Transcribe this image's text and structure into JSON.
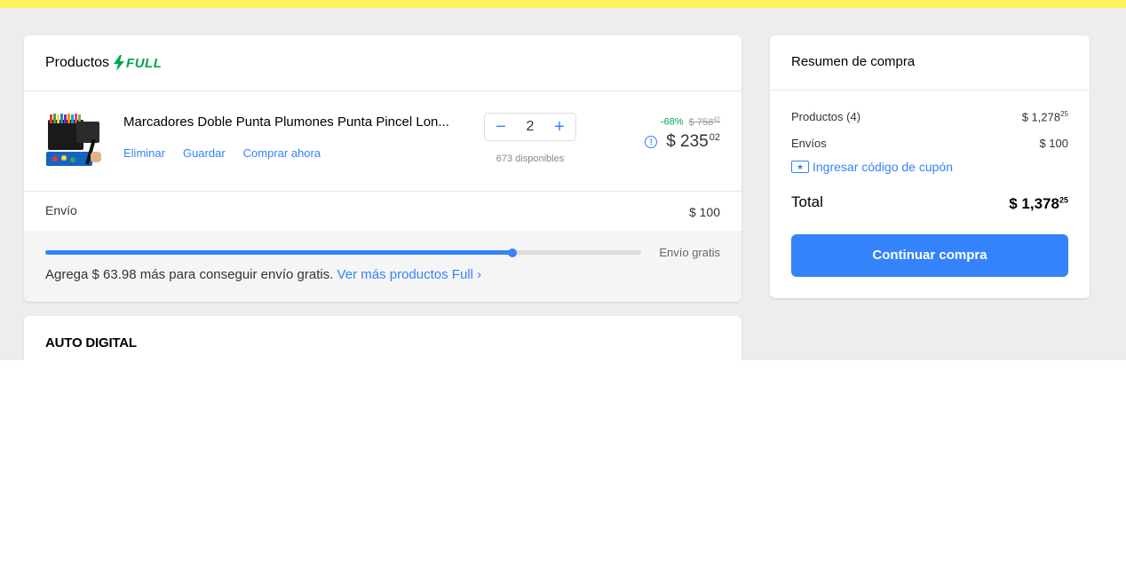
{
  "products_section": {
    "title": "Productos",
    "badge": "FULL",
    "badge_color": "#00a650"
  },
  "item": {
    "title": "Marcadores Doble Punta Plumones Punta Pincel Lon...",
    "actions": [
      "Eliminar",
      "Guardar",
      "Comprar ahora"
    ],
    "quantity": "2",
    "available": "673 disponibles",
    "discount": "-68%",
    "old_price_int": "$ 758",
    "old_price_dec": "42",
    "price_int": "$ 235",
    "price_dec": "02"
  },
  "shipping": {
    "label": "Envío",
    "value": "$ 100"
  },
  "free_shipping": {
    "progress_percent": 78.4,
    "label": "Envío gratis",
    "message": "Agrega $ 63.98 más para conseguir envío gratis.",
    "link": "Ver más productos Full ›"
  },
  "seller": {
    "name": "AUTO DIGITAL"
  },
  "summary": {
    "title": "Resumen de compra",
    "products_label": "Productos (4)",
    "products_value_int": "$ 1,278",
    "products_value_dec": "25",
    "shipping_label": "Envíos",
    "shipping_value": "$ 100",
    "coupon_label": "Ingresar código de cupón",
    "total_label": "Total",
    "total_int": "$ 1,378",
    "total_dec": "25",
    "continue_label": "Continuar compra"
  },
  "colors": {
    "accent": "#3483fa",
    "topbar": "#fff159",
    "background": "#ededed",
    "discount": "#00a650"
  }
}
